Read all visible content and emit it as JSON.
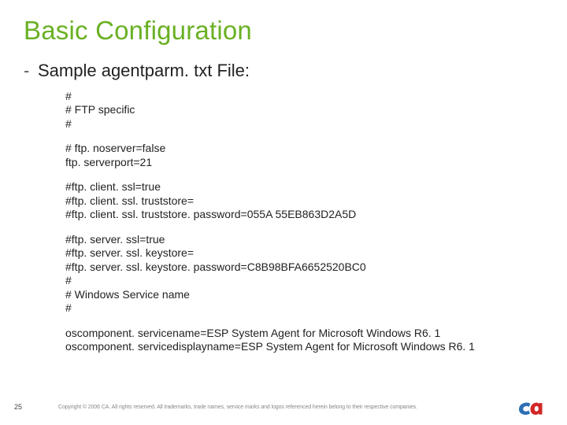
{
  "title": "Basic Configuration",
  "bullet": {
    "dash": "-",
    "text": "Sample agentparm. txt File:"
  },
  "config": {
    "g1": {
      "l1": "#",
      "l2": "# FTP specific",
      "l3": "#"
    },
    "g2": {
      "l1": "# ftp. noserver=false",
      "l2": "ftp. serverport=21"
    },
    "g3": {
      "l1": "#ftp. client. ssl=true",
      "l2": "#ftp. client. ssl. truststore=",
      "l3": "#ftp. client. ssl. truststore. password=055A 55EB863D2A5D"
    },
    "g4": {
      "l1": "#ftp. server. ssl=true",
      "l2": "#ftp. server. ssl. keystore=",
      "l3": "#ftp. server. ssl. keystore. password=C8B98BFA6652520BC0",
      "l4": "#",
      "l5": "# Windows Service name",
      "l6": "#"
    },
    "g5": {
      "l1": "oscomponent. servicename=ESP System Agent for Microsoft Windows R6. 1",
      "l2": "oscomponent. servicedisplayname=ESP System Agent for Microsoft Windows R6. 1"
    }
  },
  "footer": {
    "page": "25",
    "copyright": "Copyright © 2006 CA. All rights reserved. All trademarks, trade names, service marks and logos referenced herein belong to their respective companies."
  },
  "logo": {
    "name": "ca-logo"
  }
}
